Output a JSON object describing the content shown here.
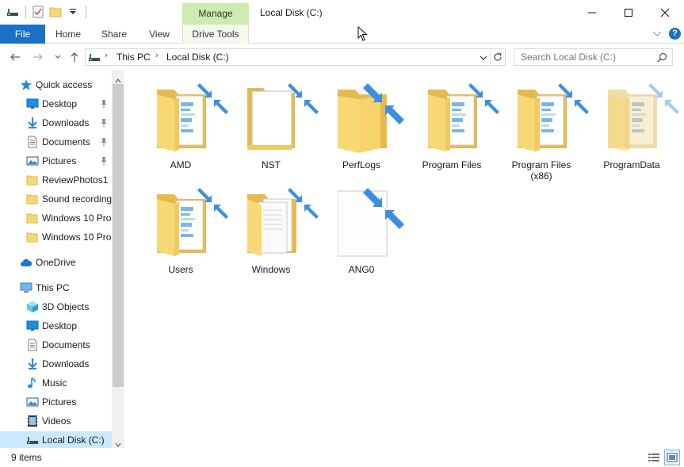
{
  "window": {
    "title": "Local Disk (C:)",
    "context_tab": "Manage",
    "controls": {
      "minimize": "–",
      "maximize": "☐",
      "close": "✕"
    }
  },
  "ribbon": {
    "tabs": [
      {
        "label": "File"
      },
      {
        "label": "Home"
      },
      {
        "label": "Share"
      },
      {
        "label": "View"
      },
      {
        "label": "Drive Tools"
      }
    ],
    "help": "?"
  },
  "address_bar": {
    "back": "←",
    "forward": "→",
    "recent": "⌄",
    "up": "↑",
    "breadcrumbs": [
      "This PC",
      "Local Disk (C:)"
    ],
    "separator": "›",
    "refresh": "↻"
  },
  "search": {
    "placeholder": "Search Local Disk (C:)"
  },
  "nav_pane": {
    "items": [
      {
        "label": "Quick access",
        "icon": "star-icon",
        "level": 0,
        "pinned": false
      },
      {
        "label": "Desktop",
        "icon": "desktop-icon",
        "level": 1,
        "pinned": true
      },
      {
        "label": "Downloads",
        "icon": "download-icon",
        "level": 1,
        "pinned": true
      },
      {
        "label": "Documents",
        "icon": "document-icon",
        "level": 1,
        "pinned": true
      },
      {
        "label": "Pictures",
        "icon": "pictures-icon",
        "level": 1,
        "pinned": true
      },
      {
        "label": "ReviewPhotos1",
        "icon": "folder-icon",
        "level": 1,
        "pinned": false
      },
      {
        "label": "Sound recordings",
        "icon": "folder-icon",
        "level": 1,
        "pinned": false
      },
      {
        "label": "Windows 10 Pro",
        "icon": "folder-icon",
        "level": 1,
        "pinned": false
      },
      {
        "label": "Windows 10 Pro",
        "icon": "folder-icon",
        "level": 1,
        "pinned": false
      },
      {
        "label": "OneDrive",
        "icon": "cloud-icon",
        "level": 0,
        "pinned": false
      },
      {
        "label": "This PC",
        "icon": "computer-icon",
        "level": 0,
        "pinned": false
      },
      {
        "label": "3D Objects",
        "icon": "cube-icon",
        "level": 1,
        "pinned": false
      },
      {
        "label": "Desktop",
        "icon": "desktop-icon",
        "level": 1,
        "pinned": false
      },
      {
        "label": "Documents",
        "icon": "document-icon",
        "level": 1,
        "pinned": false
      },
      {
        "label": "Downloads",
        "icon": "download-icon",
        "level": 1,
        "pinned": false
      },
      {
        "label": "Music",
        "icon": "music-icon",
        "level": 1,
        "pinned": false
      },
      {
        "label": "Pictures",
        "icon": "pictures-icon",
        "level": 1,
        "pinned": false
      },
      {
        "label": "Videos",
        "icon": "video-icon",
        "level": 1,
        "pinned": false
      },
      {
        "label": "Local Disk (C:)",
        "icon": "drive-icon",
        "level": 1,
        "pinned": false,
        "selected": true
      }
    ]
  },
  "content": {
    "items": [
      {
        "name": "AMD",
        "kind": "folder-docs"
      },
      {
        "name": "NST",
        "kind": "folder-open"
      },
      {
        "name": "PerfLogs",
        "kind": "folder-empty"
      },
      {
        "name": "Program Files",
        "kind": "folder-docs"
      },
      {
        "name": "Program Files\n(x86)",
        "kind": "folder-docs"
      },
      {
        "name": "ProgramData",
        "kind": "folder-docs-hidden"
      },
      {
        "name": "Users",
        "kind": "folder-docs"
      },
      {
        "name": "Windows",
        "kind": "folder-pages"
      },
      {
        "name": "ANG0",
        "kind": "file"
      }
    ]
  },
  "status_bar": {
    "item_count": "9 items"
  },
  "colors": {
    "accent": "#1a6fc7",
    "manage_tab": "#cdeab0",
    "folder": "#f8d775",
    "compress_arrow": "#3c8fe0",
    "selection": "#cce8ff"
  }
}
